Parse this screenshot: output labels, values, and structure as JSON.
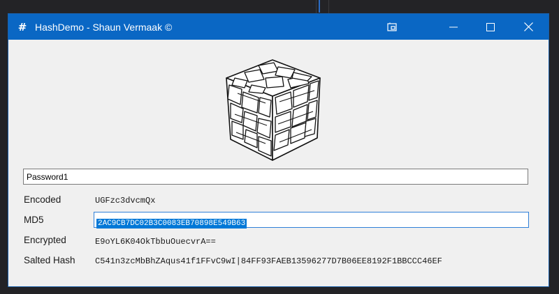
{
  "window": {
    "title": "HashDemo - Shaun Vermaak ©",
    "app_icon": "hash-icon",
    "controls": [
      "snap-icon",
      "minimize-icon",
      "maximize-icon",
      "close-icon"
    ]
  },
  "logo": "cube-logo",
  "password_input": {
    "value": "Password1"
  },
  "rows": {
    "encoded": {
      "label": "Encoded",
      "value": "UGFzc3dvcmQx"
    },
    "md5": {
      "label": "MD5",
      "value": "2AC9CB7DC02B3C0083EB70898E549B63"
    },
    "encrypted": {
      "label": "Encrypted",
      "value": "E9oYL6K04OkTbbuOuecvrA=="
    },
    "salted_hash": {
      "label": "Salted Hash",
      "value": "C541n3zcMbBhZAqus41f1FFvC9wI|84FF93FAEB13596277D7B06EE8192F1BBCCC46EF"
    }
  },
  "colors": {
    "titlebar": "#0a67c4",
    "selection": "#0078d7",
    "window_bg": "#f0f0f0"
  }
}
